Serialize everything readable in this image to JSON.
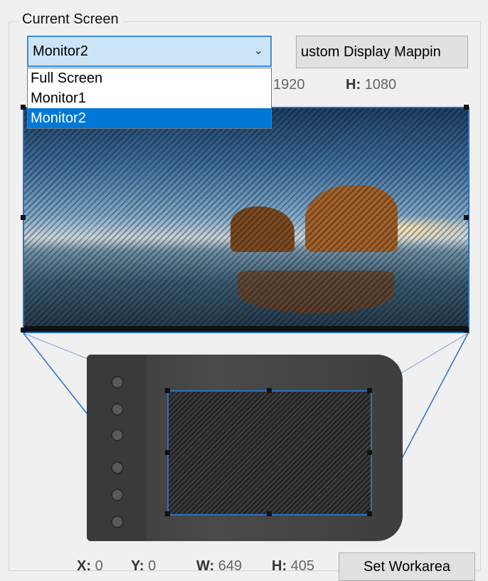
{
  "group": {
    "title": "Current Screen"
  },
  "combo": {
    "selected": "Monitor2",
    "options": [
      "Full Screen",
      "Monitor1",
      "Monitor2"
    ]
  },
  "mapping_button": {
    "label": "ustom Display Mappin"
  },
  "screen_dims": {
    "width_value": "1920",
    "height_label": "H:",
    "height_value": "1080"
  },
  "workarea": {
    "x_label": "X:",
    "x_value": "0",
    "y_label": "Y:",
    "y_value": "0",
    "w_label": "W:",
    "w_value": "649",
    "h_label": "H:",
    "h_value": "405",
    "set_button": "Set Workarea"
  },
  "colors": {
    "accent": "#2e6fc4",
    "selection": "#0078d7",
    "combo_bg": "#cce4f7"
  }
}
